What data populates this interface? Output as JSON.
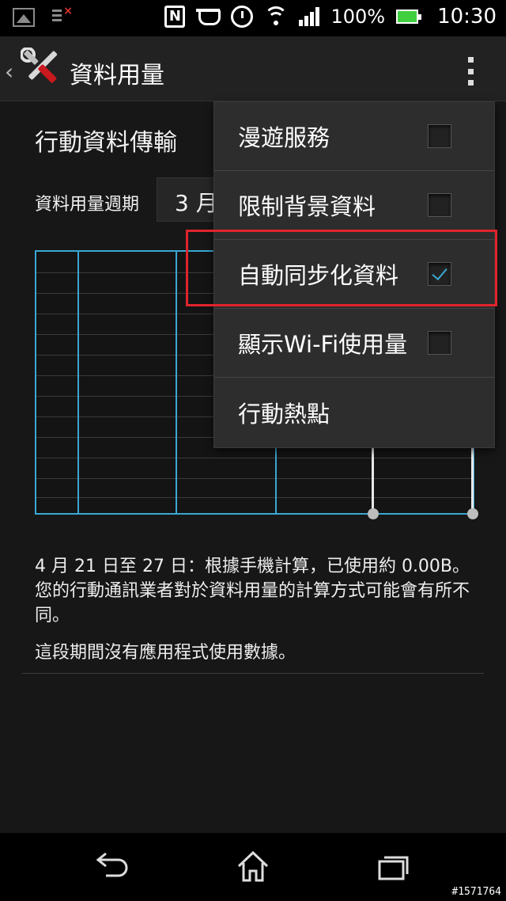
{
  "status_bar": {
    "nfc_label": "N",
    "battery_percent": "100%",
    "time": "10:30"
  },
  "action_bar": {
    "title": "資料用量",
    "back_symbol": "‹"
  },
  "main": {
    "section_title": "行動資料傳輸",
    "cycle_label": "資料用量週期",
    "cycle_value": "3 月",
    "summary": "4 月 21 日至 27 日：根據手機計算，已使用約 0.00B。您的行動通訊業者對於資料用量的計算方式可能會有所不同。",
    "no_apps": "這段期間沒有應用程式使用數據。"
  },
  "menu": {
    "items": [
      {
        "label": "漫遊服務",
        "checked": false
      },
      {
        "label": "限制背景資料",
        "checked": false
      },
      {
        "label": "自動同步化資料",
        "checked": true
      },
      {
        "label": "顯示Wi-Fi使用量",
        "checked": false
      },
      {
        "label": "行動熱點"
      }
    ]
  },
  "watermark": "#1571764",
  "colors": {
    "accent": "#3aa7d3",
    "highlight": "#e0242c",
    "background": "#171717"
  }
}
